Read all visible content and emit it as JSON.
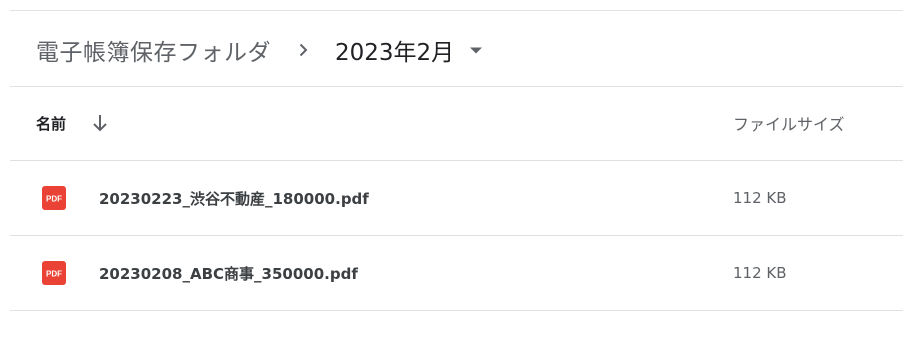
{
  "breadcrumb": {
    "root_label": "電子帳簿保存フォルダ",
    "separator_icon": "chevron-right-icon",
    "current_label": "2023年2月",
    "current_dropdown_icon": "caret-down-icon"
  },
  "table": {
    "headers": {
      "name": "名前",
      "sort_icon": "arrow-downward-icon",
      "size": "ファイルサイズ"
    },
    "rows": [
      {
        "icon": "pdf-file-icon",
        "icon_label": "PDF",
        "name": "20230223_渋谷不動産_180000.pdf",
        "size": "112 KB"
      },
      {
        "icon": "pdf-file-icon",
        "icon_label": "PDF",
        "name": "20230208_ABC商事_350000.pdf",
        "size": "112 KB"
      }
    ]
  },
  "colors": {
    "pdf_red": "#ea4335",
    "divider": "#e0e0e0",
    "text_primary": "#202124",
    "text_secondary": "#5f6368"
  }
}
